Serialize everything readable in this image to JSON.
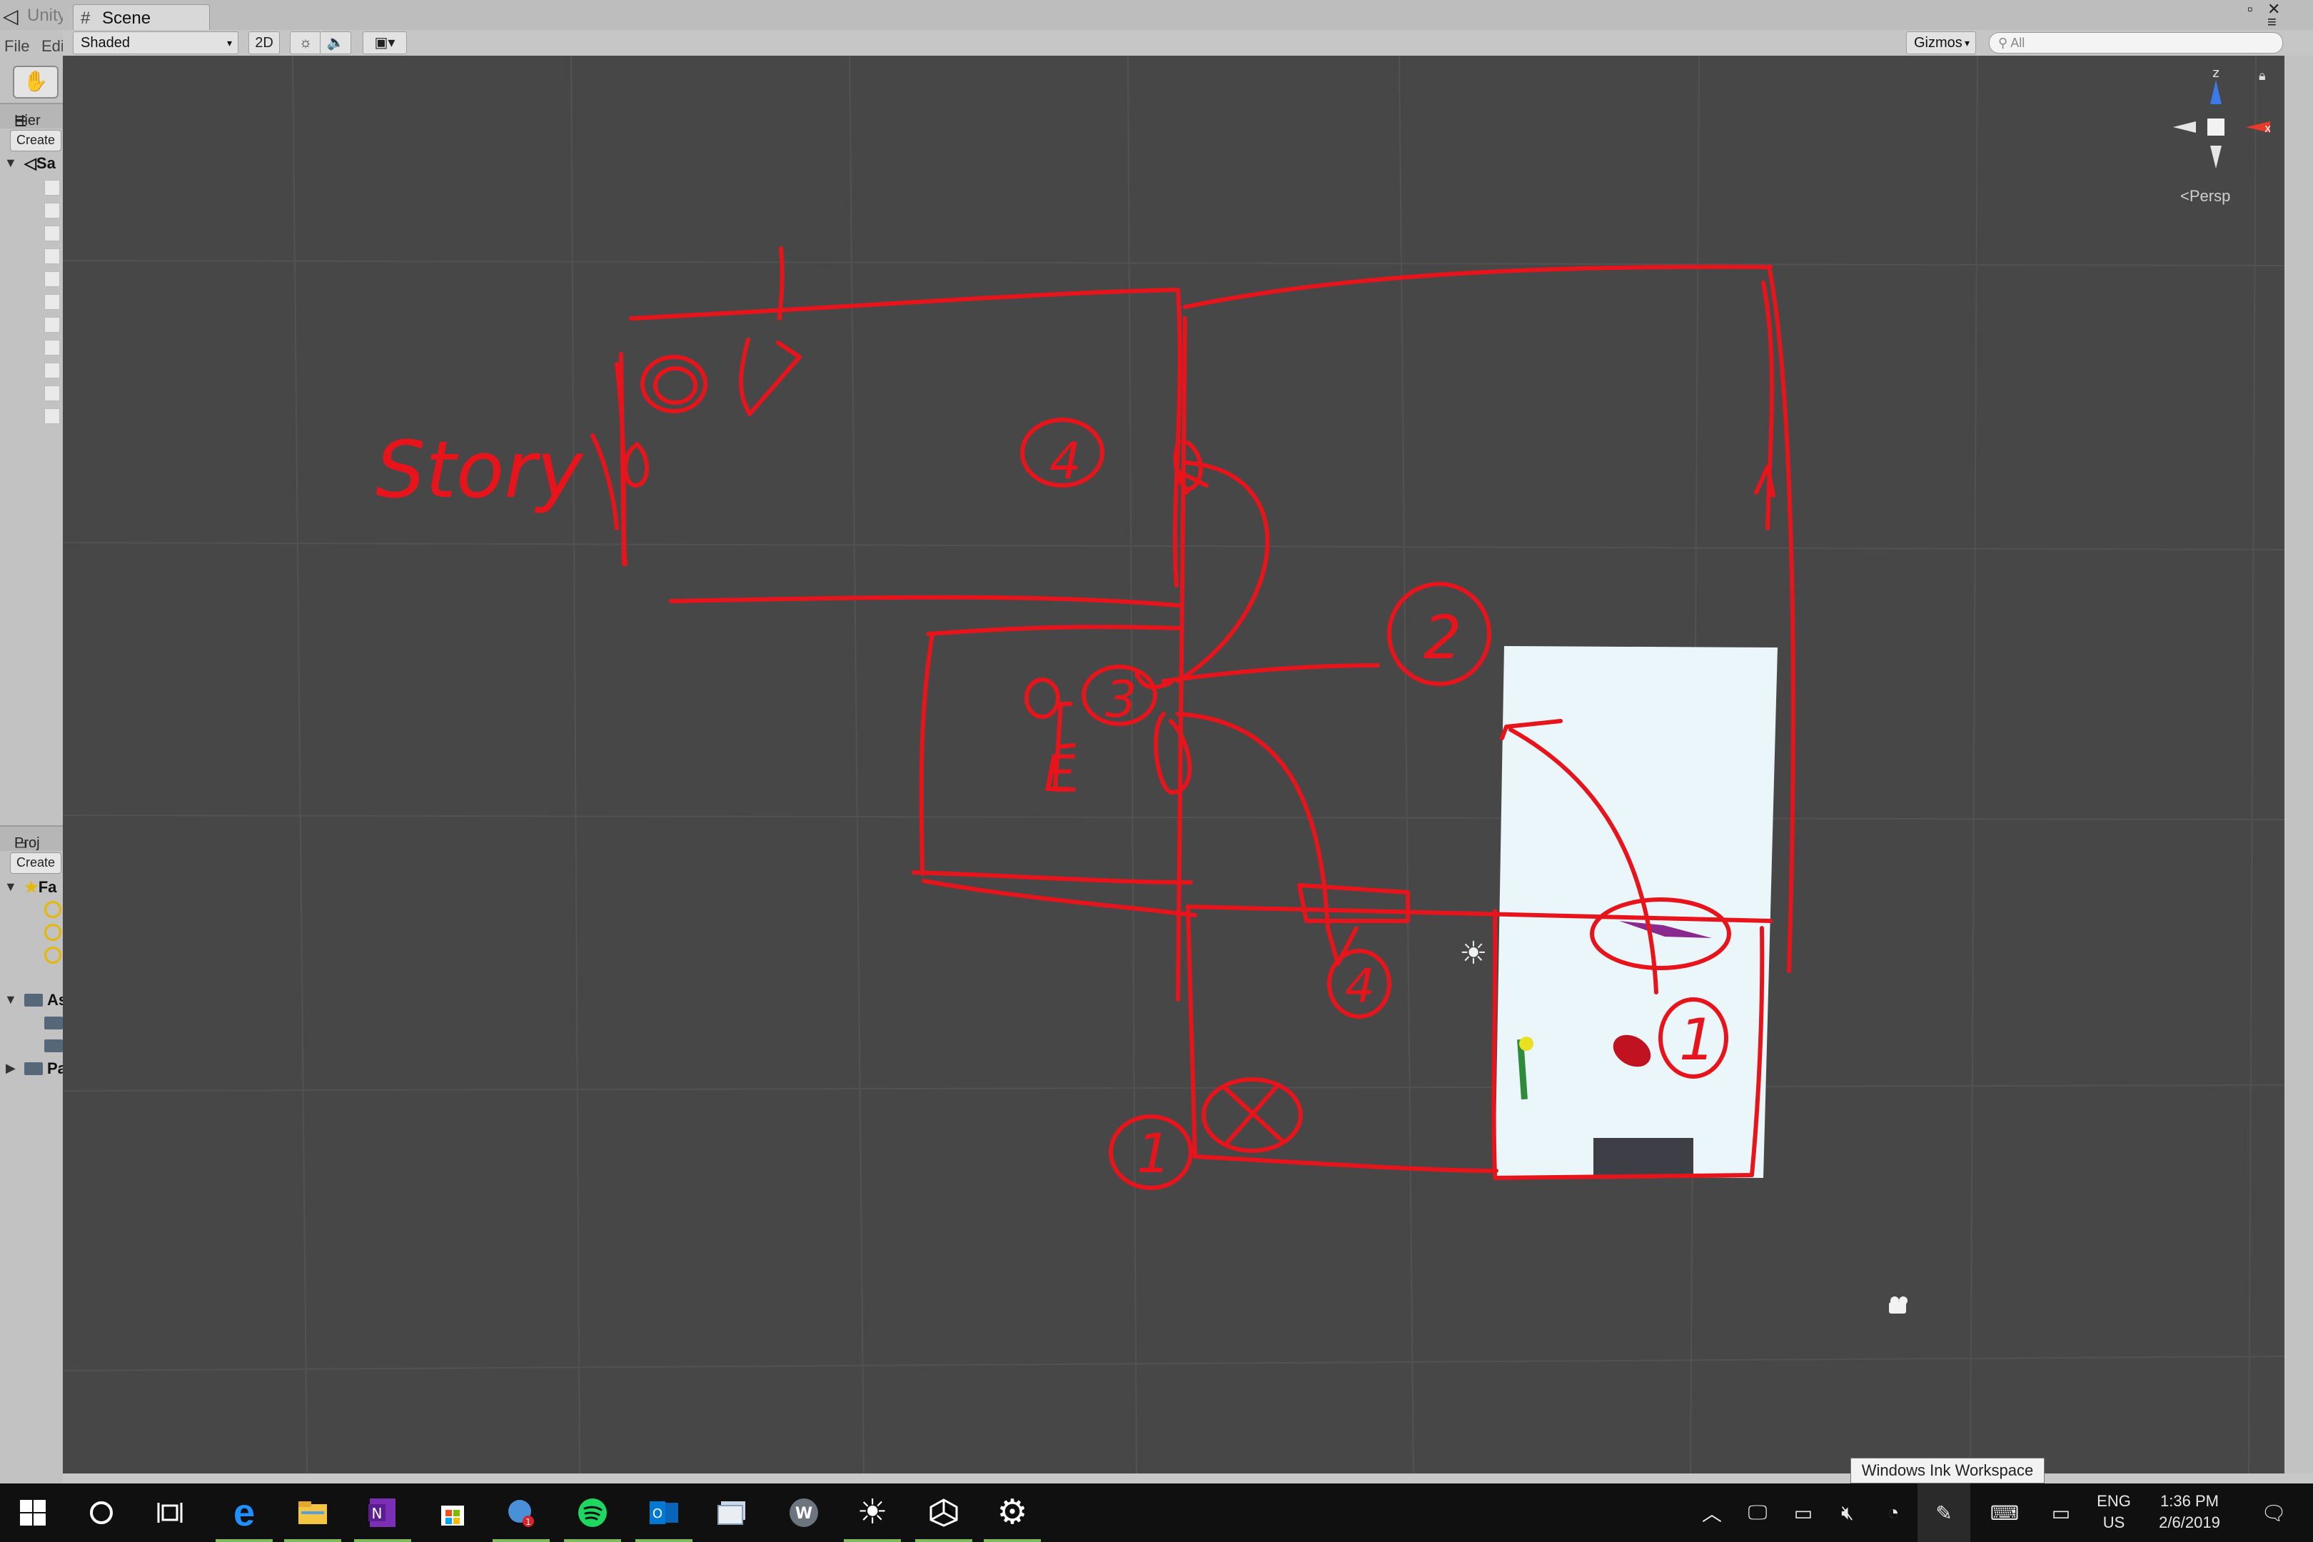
{
  "unity": {
    "title": "Unity",
    "menu": {
      "file": "File",
      "edit": "Edi"
    },
    "hierarchy": {
      "tab": "Hier",
      "create": "Create",
      "scene_root": "Sa"
    },
    "project": {
      "tab": "Proj",
      "create": "Create",
      "favorites": "Fa",
      "assets": "As",
      "packages": "Pa"
    }
  },
  "scene": {
    "tab_label": "Scene",
    "shading_mode": "Shaded",
    "btn_2d": "2D",
    "gizmos_label": "Gizmos",
    "search_placeholder": "All",
    "projection_label": "Persp",
    "axis_z": "z",
    "axis_x": "x"
  },
  "sketch_labels": {
    "story": "Story",
    "num_1": "1",
    "num_2": "2",
    "num_3": "3",
    "num_4_top": "4",
    "num_4_bottom": "4",
    "letter_e": "E"
  },
  "tooltip": "Windows Ink Workspace",
  "taskbar": {
    "apps": [
      {
        "name": "start-icon"
      },
      {
        "name": "cortana-icon"
      },
      {
        "name": "task-view-icon"
      },
      {
        "name": "edge-icon",
        "running": true
      },
      {
        "name": "file-explorer-icon",
        "running": true
      },
      {
        "name": "onenote-icon",
        "running": true
      },
      {
        "name": "store-icon"
      },
      {
        "name": "network-app-icon",
        "running": true,
        "badge": "1"
      },
      {
        "name": "spotify-icon",
        "running": true
      },
      {
        "name": "outlook-icon",
        "running": true
      },
      {
        "name": "photos-icon"
      },
      {
        "name": "w-app-icon"
      },
      {
        "name": "brightness-icon",
        "running": true
      },
      {
        "name": "unity-icon",
        "running": true
      },
      {
        "name": "settings-icon",
        "running": true
      }
    ],
    "language": "ENG",
    "region": "US",
    "time": "1:36 PM",
    "date": "2/6/2019"
  },
  "colors": {
    "sketch_red": "#e8141c",
    "scene_bg": "#474747",
    "taskbar_bg": "#101010",
    "running_indicator": "#7fba61",
    "room_floor": "#eaf6fa"
  }
}
